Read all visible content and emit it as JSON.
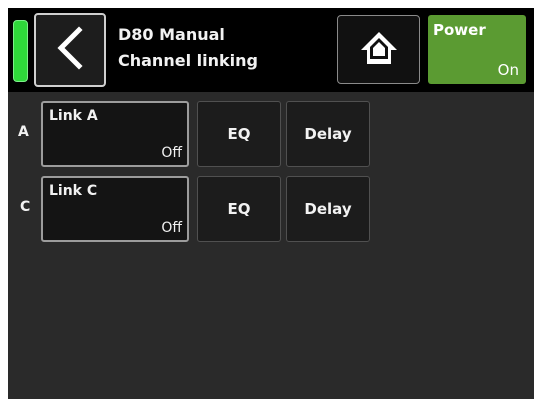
{
  "header": {
    "title_line1": "D80 Manual",
    "title_line2": "Channel linking",
    "back_icon": "chevron-left-icon",
    "home_icon": "home-icon",
    "status_color": "#2fd83a"
  },
  "power": {
    "label": "Power",
    "value": "On",
    "color": "#5b9b32"
  },
  "rows": [
    {
      "channel": "A",
      "link_label": "Link A",
      "link_value": "Off",
      "eq_label": "EQ",
      "delay_label": "Delay"
    },
    {
      "channel": "C",
      "link_label": "Link C",
      "link_value": "Off",
      "eq_label": "EQ",
      "delay_label": "Delay"
    }
  ]
}
